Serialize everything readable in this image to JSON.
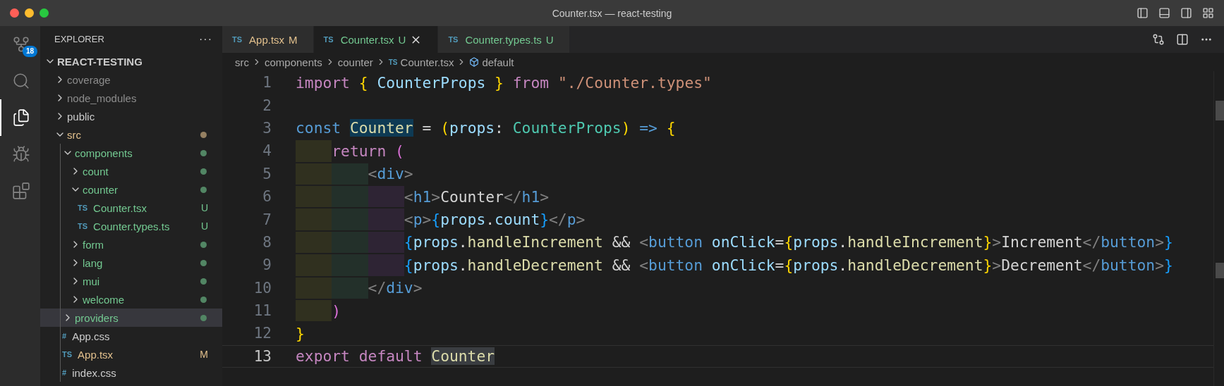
{
  "window": {
    "title": "Counter.tsx — react-testing"
  },
  "activity_bar": [
    {
      "kind": "source-control",
      "selected": false,
      "badge": "18"
    },
    {
      "kind": "search",
      "selected": false
    },
    {
      "kind": "explorer",
      "selected": true
    },
    {
      "kind": "debug",
      "selected": false
    },
    {
      "kind": "extensions",
      "selected": false
    }
  ],
  "sidebar": {
    "title": "EXPLORER",
    "more": "···",
    "root": {
      "label": "REACT-TESTING",
      "expanded": true,
      "children": [
        {
          "kind": "folder",
          "label": "coverage",
          "expanded": false,
          "color": "#8c8c8c",
          "dot": false,
          "selected": false
        },
        {
          "kind": "folder",
          "label": "node_modules",
          "expanded": false,
          "color": "#8c8c8c",
          "dot": false,
          "selected": false
        },
        {
          "kind": "folder",
          "label": "public",
          "expanded": false,
          "color": "#cccccc",
          "dot": false,
          "selected": false
        },
        {
          "kind": "folder",
          "label": "src",
          "expanded": true,
          "color": "#e2c08d",
          "dot": true,
          "selected": false,
          "children": [
            {
              "kind": "folder",
              "label": "components",
              "expanded": true,
              "color": "#73c991",
              "dot": true,
              "selected": false,
              "children": [
                {
                  "kind": "folder",
                  "label": "count",
                  "expanded": false,
                  "color": "#73c991",
                  "dot": true,
                  "selected": false
                },
                {
                  "kind": "folder",
                  "label": "counter",
                  "expanded": true,
                  "color": "#73c991",
                  "dot": true,
                  "selected": false,
                  "children": [
                    {
                      "kind": "file",
                      "icon": "TS",
                      "label": "Counter.tsx",
                      "color": "#73c991",
                      "badge": "U",
                      "selected": false
                    },
                    {
                      "kind": "file",
                      "icon": "TS",
                      "label": "Counter.types.ts",
                      "color": "#73c991",
                      "badge": "U",
                      "selected": false
                    }
                  ]
                },
                {
                  "kind": "folder",
                  "label": "form",
                  "expanded": false,
                  "color": "#73c991",
                  "dot": true,
                  "selected": false
                },
                {
                  "kind": "folder",
                  "label": "lang",
                  "expanded": false,
                  "color": "#73c991",
                  "dot": true,
                  "selected": false
                },
                {
                  "kind": "folder",
                  "label": "mui",
                  "expanded": false,
                  "color": "#73c991",
                  "dot": true,
                  "selected": false
                },
                {
                  "kind": "folder",
                  "label": "welcome",
                  "expanded": false,
                  "color": "#73c991",
                  "dot": true,
                  "selected": false
                }
              ]
            },
            {
              "kind": "folder",
              "label": "providers",
              "expanded": false,
              "color": "#73c991",
              "dot": true,
              "selected": true
            },
            {
              "kind": "file",
              "icon": "#",
              "label": "App.css",
              "color": "#cccccc",
              "selected": false
            },
            {
              "kind": "file",
              "icon": "TS",
              "label": "App.tsx",
              "color": "#e2c08d",
              "badge": "M",
              "selected": false
            },
            {
              "kind": "file",
              "icon": "#",
              "label": "index.css",
              "color": "#cccccc",
              "selected": false
            }
          ]
        }
      ]
    }
  },
  "tabs": [
    {
      "icon": "TS",
      "label": "App.tsx",
      "badge": "M",
      "color": "#e2c08d",
      "selected": false
    },
    {
      "icon": "TS",
      "label": "Counter.tsx",
      "badge": "U",
      "color": "#73c991",
      "selected": true
    },
    {
      "icon": "TS",
      "label": "Counter.types.ts",
      "badge": "U",
      "color": "#73c991",
      "selected": false
    }
  ],
  "breadcrumb": [
    {
      "kind": "folder",
      "label": "src"
    },
    {
      "kind": "folder",
      "label": "components"
    },
    {
      "kind": "folder",
      "label": "counter"
    },
    {
      "kind": "file",
      "icon": "TS",
      "label": "Counter.tsx"
    },
    {
      "kind": "symbol",
      "label": "default"
    }
  ],
  "code": [
    {
      "number": "1",
      "current": false,
      "tokens": [
        {
          "text": "import ",
          "kind": "keyword"
        },
        {
          "text": "{",
          "kind": "bracket1"
        },
        {
          "text": " CounterProps ",
          "kind": "variable"
        },
        {
          "text": "}",
          "kind": "bracket1"
        },
        {
          "text": " from ",
          "kind": "keyword"
        },
        {
          "text": "\"./Counter.types\"",
          "kind": "string"
        }
      ]
    },
    {
      "number": "2",
      "current": false
    },
    {
      "number": "3",
      "current": false,
      "tokens": [
        {
          "text": "const ",
          "kind": "storage"
        },
        {
          "text": "Counter",
          "kind": "function",
          "selected": true
        },
        {
          "text": " = ",
          "kind": "plain"
        },
        {
          "text": "(",
          "kind": "bracket1"
        },
        {
          "text": "props",
          "kind": "variable"
        },
        {
          "text": ": ",
          "kind": "plain"
        },
        {
          "text": "CounterProps",
          "kind": "type"
        },
        {
          "text": ")",
          "kind": "bracket1"
        },
        {
          "text": " => ",
          "kind": "storage"
        },
        {
          "text": "{",
          "kind": "bracket1"
        }
      ]
    },
    {
      "number": "4",
      "current": false,
      "tokens": [
        {
          "text": "    return ",
          "kind": "keyword"
        },
        {
          "text": "(",
          "kind": "bracket2"
        }
      ]
    },
    {
      "number": "5",
      "current": false,
      "tokens": [
        {
          "text": "        <",
          "kind": "punct"
        },
        {
          "text": "div",
          "kind": "tag"
        },
        {
          "text": ">",
          "kind": "punct"
        }
      ]
    },
    {
      "number": "6",
      "current": false,
      "tokens": [
        {
          "text": "            <",
          "kind": "punct"
        },
        {
          "text": "h1",
          "kind": "tag"
        },
        {
          "text": ">",
          "kind": "punct"
        },
        {
          "text": "Counter",
          "kind": "text"
        },
        {
          "text": "</",
          "kind": "punct"
        },
        {
          "text": "h1",
          "kind": "tag"
        },
        {
          "text": ">",
          "kind": "punct"
        }
      ]
    },
    {
      "number": "7",
      "current": false,
      "tokens": [
        {
          "text": "            <",
          "kind": "punct"
        },
        {
          "text": "p",
          "kind": "tag"
        },
        {
          "text": ">",
          "kind": "punct"
        },
        {
          "text": "{",
          "kind": "bracket3"
        },
        {
          "text": "props",
          "kind": "variable"
        },
        {
          "text": ".",
          "kind": "plain"
        },
        {
          "text": "count",
          "kind": "variable"
        },
        {
          "text": "}",
          "kind": "bracket3"
        },
        {
          "text": "</",
          "kind": "punct"
        },
        {
          "text": "p",
          "kind": "tag"
        },
        {
          "text": ">",
          "kind": "punct"
        }
      ]
    },
    {
      "number": "8",
      "current": false,
      "tokens": [
        {
          "text": "            {",
          "kind": "bracket3"
        },
        {
          "text": "props",
          "kind": "variable"
        },
        {
          "text": ".",
          "kind": "plain"
        },
        {
          "text": "handleIncrement",
          "kind": "function"
        },
        {
          "text": " && ",
          "kind": "plain"
        },
        {
          "text": "<",
          "kind": "punct"
        },
        {
          "text": "button",
          "kind": "tag"
        },
        {
          "text": " onClick",
          "kind": "variable"
        },
        {
          "text": "=",
          "kind": "plain"
        },
        {
          "text": "{",
          "kind": "bracket1"
        },
        {
          "text": "props",
          "kind": "variable"
        },
        {
          "text": ".",
          "kind": "plain"
        },
        {
          "text": "handleIncrement",
          "kind": "function"
        },
        {
          "text": "}",
          "kind": "bracket1"
        },
        {
          "text": ">",
          "kind": "punct"
        },
        {
          "text": "Increment",
          "kind": "text"
        },
        {
          "text": "</",
          "kind": "punct"
        },
        {
          "text": "button",
          "kind": "tag"
        },
        {
          "text": ">",
          "kind": "punct"
        },
        {
          "text": "}",
          "kind": "bracket3"
        }
      ]
    },
    {
      "number": "9",
      "current": false,
      "tokens": [
        {
          "text": "            {",
          "kind": "bracket3"
        },
        {
          "text": "props",
          "kind": "variable"
        },
        {
          "text": ".",
          "kind": "plain"
        },
        {
          "text": "handleDecrement",
          "kind": "function"
        },
        {
          "text": " && ",
          "kind": "plain"
        },
        {
          "text": "<",
          "kind": "punct"
        },
        {
          "text": "button",
          "kind": "tag"
        },
        {
          "text": " onClick",
          "kind": "variable"
        },
        {
          "text": "=",
          "kind": "plain"
        },
        {
          "text": "{",
          "kind": "bracket1"
        },
        {
          "text": "props",
          "kind": "variable"
        },
        {
          "text": ".",
          "kind": "plain"
        },
        {
          "text": "handleDecrement",
          "kind": "function"
        },
        {
          "text": "}",
          "kind": "bracket1"
        },
        {
          "text": ">",
          "kind": "punct"
        },
        {
          "text": "Decrement",
          "kind": "text"
        },
        {
          "text": "</",
          "kind": "punct"
        },
        {
          "text": "button",
          "kind": "tag"
        },
        {
          "text": ">",
          "kind": "punct"
        },
        {
          "text": "}",
          "kind": "bracket3"
        }
      ]
    },
    {
      "number": "10",
      "current": false,
      "tokens": [
        {
          "text": "        </",
          "kind": "punct"
        },
        {
          "text": "div",
          "kind": "tag"
        },
        {
          "text": ">",
          "kind": "punct"
        }
      ]
    },
    {
      "number": "11",
      "current": false,
      "tokens": [
        {
          "text": "    )",
          "kind": "bracket2"
        }
      ]
    },
    {
      "number": "12",
      "current": false,
      "tokens": [
        {
          "text": "}",
          "kind": "bracket1"
        }
      ]
    },
    {
      "number": "13",
      "current": true,
      "tokens": [
        {
          "text": "export default ",
          "kind": "keyword"
        },
        {
          "text": "Counter",
          "kind": "function",
          "highlighted": true
        }
      ]
    }
  ]
}
